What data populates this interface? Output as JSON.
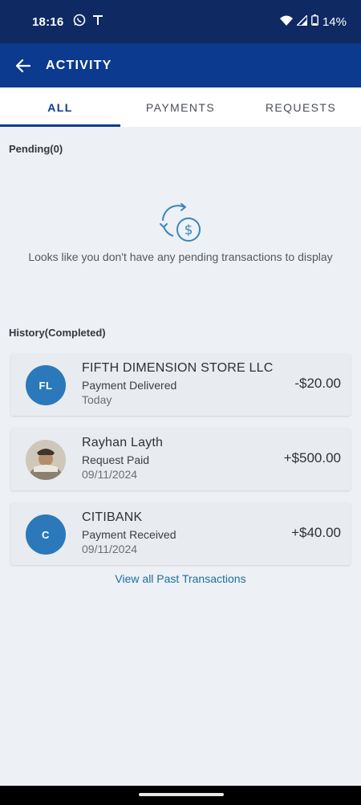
{
  "status_bar": {
    "time": "18:16",
    "battery": "14%",
    "icons": [
      "whatsapp-icon",
      "t-mobile-icon",
      "wifi-icon",
      "signal-icon",
      "battery-icon"
    ]
  },
  "app_bar": {
    "title": "ACTIVITY"
  },
  "tabs": [
    {
      "label": "ALL",
      "active": true
    },
    {
      "label": "PAYMENTS",
      "active": false
    },
    {
      "label": "REQUESTS",
      "active": false
    }
  ],
  "pending": {
    "label": "Pending(0)",
    "empty_message": "Looks like you don't have any pending transactions to display"
  },
  "history": {
    "label": "History(Completed)",
    "items": [
      {
        "initials": "FL",
        "name": "FIFTH DIMENSION STORE LLC",
        "status": "Payment Delivered",
        "date": "Today",
        "amount": "-$20.00"
      },
      {
        "initials": "",
        "name": "Rayhan Layth",
        "status": "Request Paid",
        "date": "09/11/2024",
        "amount": "+$500.00"
      },
      {
        "initials": "C",
        "name": "CITIBANK",
        "status": "Payment Received",
        "date": "09/11/2024",
        "amount": "+$40.00"
      }
    ],
    "view_all": "View all Past Transactions"
  },
  "colors": {
    "status_bar": "#0f2a62",
    "app_bar": "#0b3a8e",
    "accent": "#0d3b8f",
    "avatar": "#2b78ba",
    "link": "#1e6ea0",
    "background": "#edf0f4"
  }
}
